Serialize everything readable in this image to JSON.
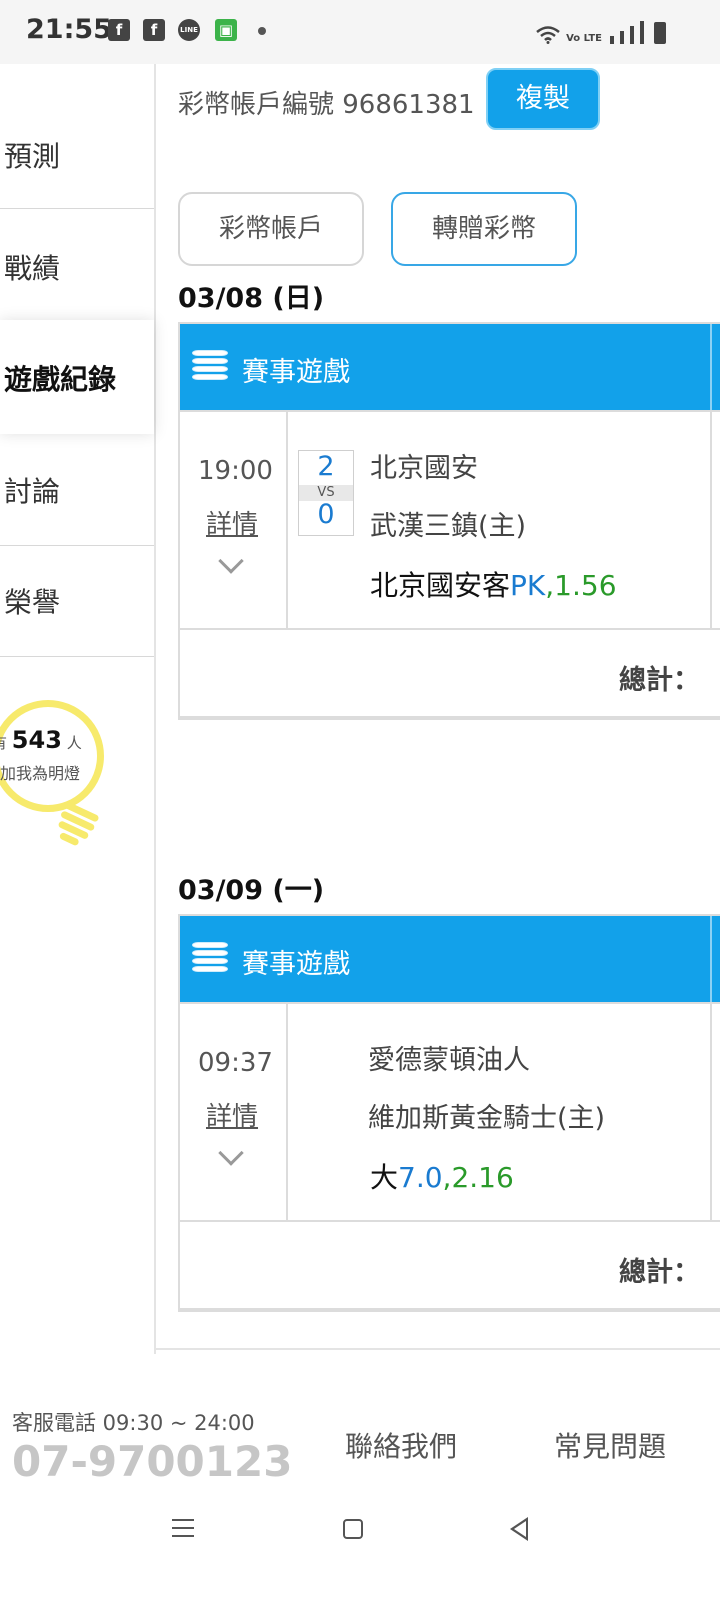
{
  "status_bar": {
    "time": "21:55",
    "app_icons": [
      "facebook-icon",
      "facebook-icon",
      "line-icon",
      "android-icon"
    ],
    "system_icons": [
      "wifi-icon",
      "volte-icon",
      "signal-icon",
      "battery-icon"
    ],
    "volte_text": "Vo LTE"
  },
  "sidebar": {
    "items": [
      {
        "label": "預測"
      },
      {
        "label": "戰績"
      },
      {
        "label": "遊戲紀錄",
        "active": true
      },
      {
        "label": "討論"
      },
      {
        "label": "榮譽"
      }
    ],
    "bulb": {
      "prefix": "有",
      "count": "543",
      "suffix": "人",
      "line2": "加我為明燈",
      "color": "#f7ea6c"
    }
  },
  "main": {
    "account_label": "彩幣帳戶編號 96861381",
    "copy_button": "複製",
    "tabs": [
      "彩幣帳戶",
      "轉贈彩幣"
    ],
    "sections": [
      {
        "date": "03/08 (日)",
        "card_title": "賽事遊戲",
        "time": "19:00",
        "detail": "詳情",
        "score_top": "2",
        "vs": "VS",
        "score_bottom": "0",
        "team1": "北京國安",
        "team2": "武漢三鎮(主)",
        "pick_main": "北京國安客",
        "pick_blue": "PK",
        "pick_green": ",1.56",
        "total_label": "總計："
      },
      {
        "date": "03/09 (一)",
        "card_title": "賽事遊戲",
        "time": "09:37",
        "detail": "詳情",
        "team1": "愛德蒙頓油人",
        "team2": "維加斯黃金騎士(主)",
        "pick_main": "大",
        "pick_blue": "7.0",
        "pick_green": ",2.16",
        "total_label": "總計："
      }
    ]
  },
  "footer": {
    "phone_label": "客服電話 09:30 ~ 24:00",
    "phone": "07-9700123",
    "contact": "聯絡我們",
    "faq": "常見問題"
  },
  "colors": {
    "accent": "#12a1ea",
    "blue_text": "#1a7bd0",
    "green_text": "#2a9a2a"
  }
}
